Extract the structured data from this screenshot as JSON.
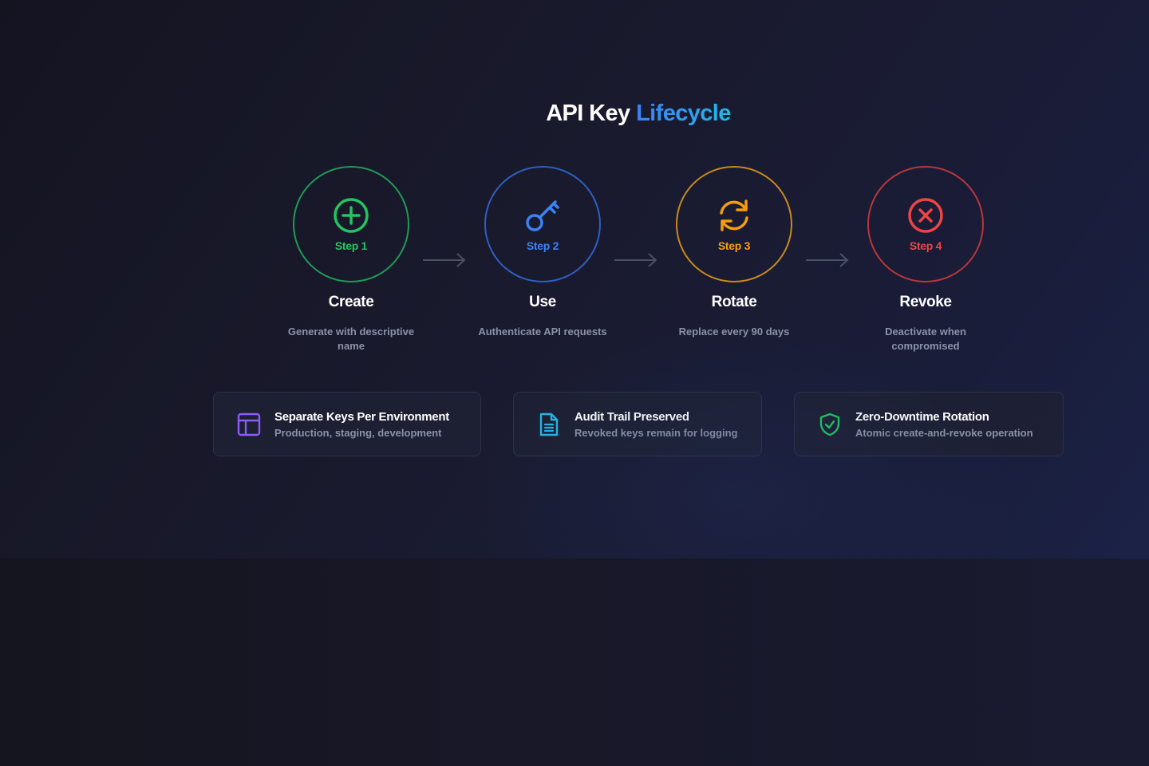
{
  "title": {
    "main": "API Key",
    "accent": "Lifecycle"
  },
  "steps": [
    {
      "step": "Step 1",
      "name": "Create",
      "desc": "Generate with descriptive name",
      "icon": "plus-circle-icon",
      "color": "#22c55e",
      "ring": "#1f9b55"
    },
    {
      "step": "Step 2",
      "name": "Use",
      "desc": "Authenticate API requests",
      "icon": "key-icon",
      "color": "#3b82f6",
      "ring": "#2f5fc4"
    },
    {
      "step": "Step 3",
      "name": "Rotate",
      "desc": "Replace every 90 days",
      "icon": "refresh-icon",
      "color": "#f59e0b",
      "ring": "#c98a1c"
    },
    {
      "step": "Step 4",
      "name": "Revoke",
      "desc": "Deactivate when compromised",
      "icon": "x-circle-icon",
      "color": "#ef4444",
      "ring": "#b8373c"
    }
  ],
  "cards": [
    {
      "title": "Separate Keys Per Environment",
      "sub": "Production, staging, development",
      "icon": "layout-icon",
      "color": "#8b5cf6"
    },
    {
      "title": "Audit Trail Preserved",
      "sub": "Revoked keys remain for logging",
      "icon": "document-icon",
      "color": "#22b8e8"
    },
    {
      "title": "Zero-Downtime Rotation",
      "sub": "Atomic create-and-revoke operation",
      "icon": "shield-check-icon",
      "color": "#22c55e"
    }
  ]
}
